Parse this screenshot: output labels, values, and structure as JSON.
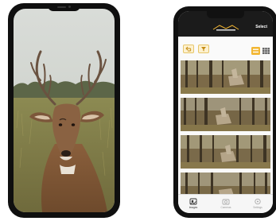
{
  "left_phone": {
    "photo": "trail-camera-photo-whitetail-buck"
  },
  "right_phone": {
    "header": {
      "select_label": "Select"
    },
    "toolbar": {
      "filter_icon": "filter-icon",
      "back_icon": "undo-icon",
      "view_modes": [
        "list-view-icon",
        "grid-view-icon"
      ],
      "active_view": "list-view-icon"
    },
    "thumbnails": [
      {
        "photo": "deer-in-forest"
      },
      {
        "photo": "deer-in-forest"
      },
      {
        "photo": "deer-in-forest"
      },
      {
        "photo": "deer-in-forest"
      }
    ],
    "tabs": [
      {
        "label": "Images",
        "icon": "images-icon",
        "active": true
      },
      {
        "label": "Cameras",
        "icon": "camera-icon",
        "active": false
      },
      {
        "label": "Settings",
        "icon": "settings-icon",
        "active": false
      }
    ],
    "colors": {
      "accent": "#f2b632",
      "header_bg": "#1b1b1b"
    }
  }
}
